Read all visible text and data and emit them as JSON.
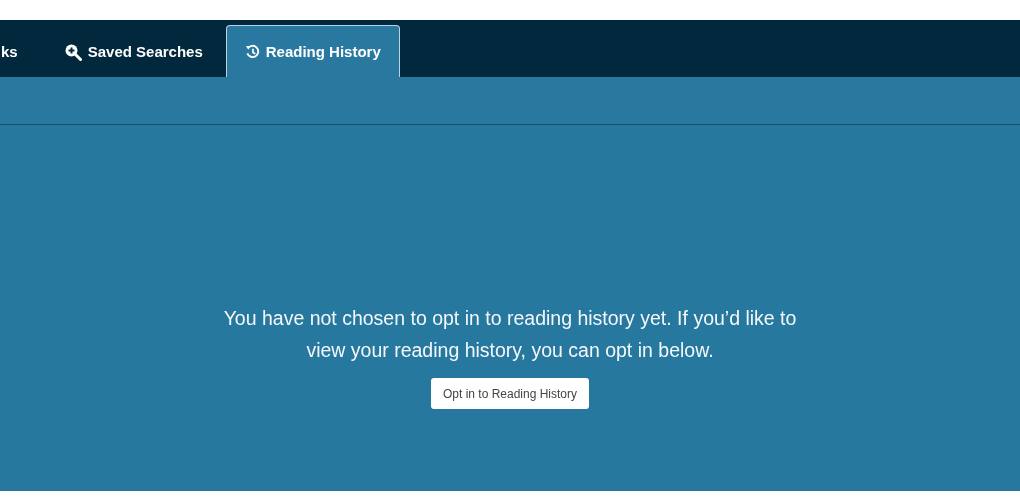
{
  "tabs": [
    {
      "label": "ks",
      "kind": "plain",
      "selected": false
    },
    {
      "label": "Saved Searches",
      "kind": "search",
      "selected": false
    },
    {
      "label": "Reading History",
      "kind": "history",
      "selected": true
    }
  ],
  "message": "You have not chosen to opt in to reading history yet. If you’d like to view your reading history, you can opt in below.",
  "button": "Opt in to Reading History"
}
